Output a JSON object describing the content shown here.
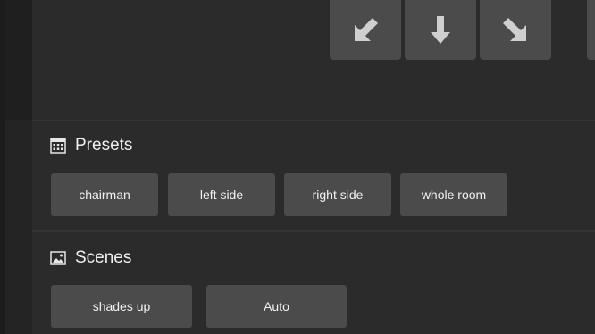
{
  "camera_pad": {
    "buttons": [
      {
        "name": "down-left",
        "icon": "arrow-down-left-icon"
      },
      {
        "name": "down",
        "icon": "arrow-down-icon"
      },
      {
        "name": "down-right",
        "icon": "arrow-down-right-icon"
      }
    ]
  },
  "presets": {
    "title": "Presets",
    "icon": "grid-icon",
    "items": [
      "chairman",
      "left side",
      "right side",
      "whole room"
    ]
  },
  "scenes": {
    "title": "Scenes",
    "icon": "image-icon",
    "items": [
      "shades up",
      "Auto"
    ]
  },
  "colors": {
    "background": "#242424",
    "panel": "#2b2b2b",
    "button": "#4b4b4b",
    "text": "#f2f2f2",
    "arrow": "#cfcfcf"
  }
}
